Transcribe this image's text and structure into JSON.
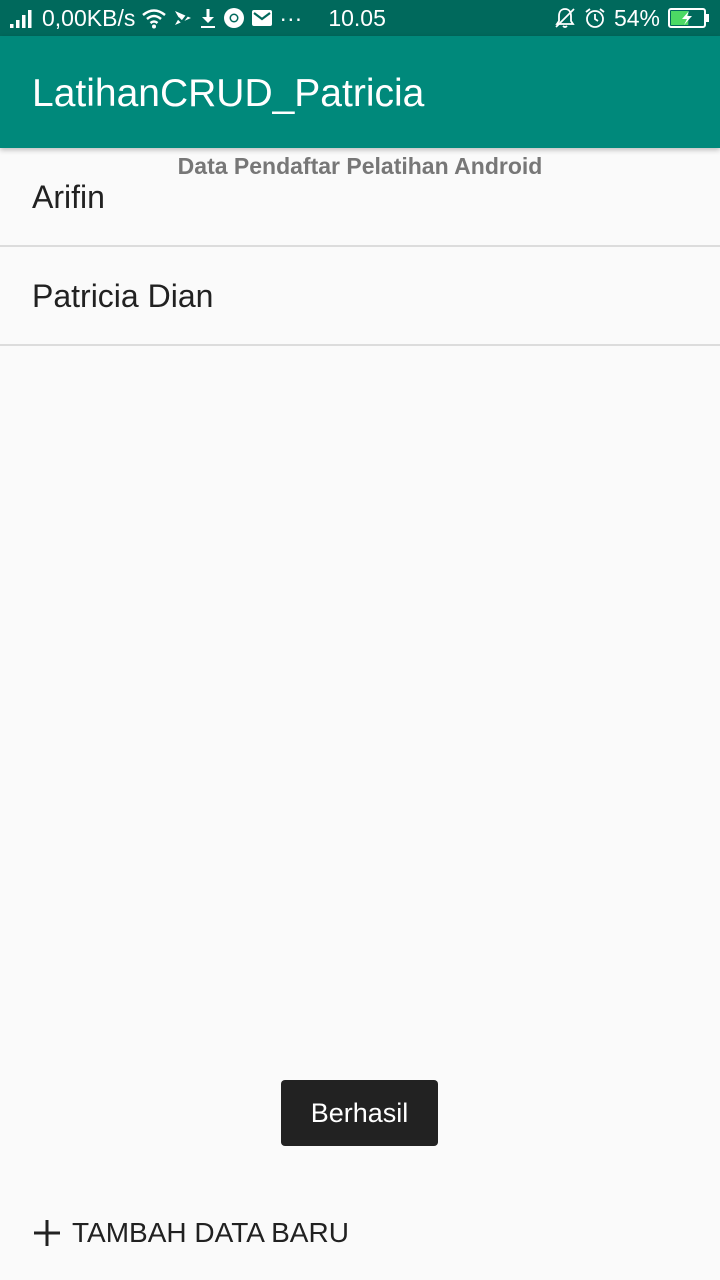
{
  "status_bar": {
    "network_speed": "0,00KB/s",
    "more_indicator": "···",
    "time": "10.05",
    "battery_percent": "54%",
    "battery_level": 0.54,
    "charging": true,
    "icons": [
      "signal-icon",
      "wifi-icon",
      "vpn-icon",
      "download-icon",
      "chrome-icon",
      "gmail-icon",
      "notifications-off-icon",
      "alarm-icon",
      "battery-charging-icon"
    ]
  },
  "app_bar": {
    "title": "LatihanCRUD_Patricia"
  },
  "list": {
    "heading": "Data Pendaftar Pelatihan Android",
    "items": [
      {
        "label": "Arifin"
      },
      {
        "label": "Patricia Dian"
      }
    ]
  },
  "toast": {
    "message": "Berhasil"
  },
  "add_button": {
    "icon": "plus-icon",
    "label": "TAMBAH DATA BARU"
  },
  "colors": {
    "status_bar": "#00695c",
    "app_bar": "#00897b",
    "background": "#fafafa",
    "toast": "#222222",
    "battery_fill": "#4cd964"
  }
}
